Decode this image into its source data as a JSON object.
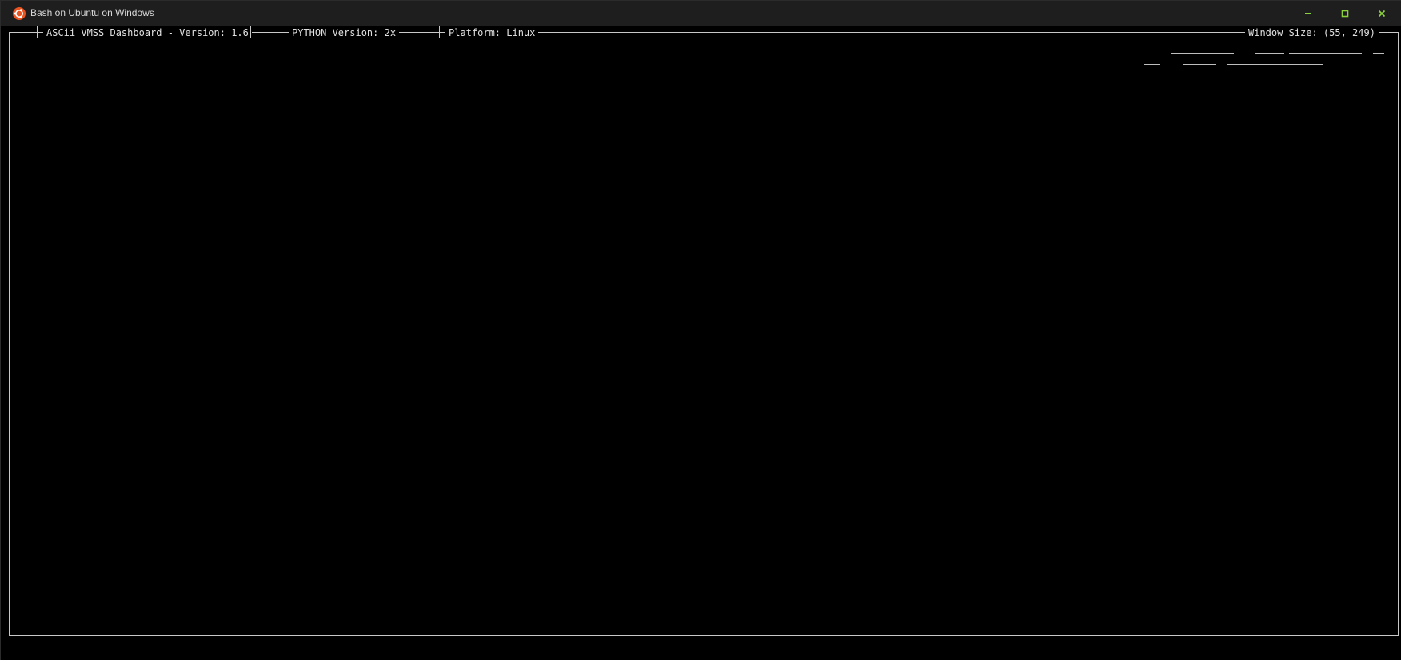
{
  "window": {
    "title": "Bash on Ubuntu on Windows",
    "icon": "ubuntu-logo-icon",
    "controls": [
      "minimize-icon",
      "maximize-icon",
      "close-icon"
    ],
    "accent_color": "#8bd13a",
    "icon_color": "#e95420"
  },
  "dashboard": {
    "app_label": "ASCii VMSS Dashboard - Version: 1.6",
    "python_label": "PYTHON Version: 2x",
    "platform_label": "Platform: Linux",
    "window_size_label": "Window Size: (55, 249)"
  }
}
